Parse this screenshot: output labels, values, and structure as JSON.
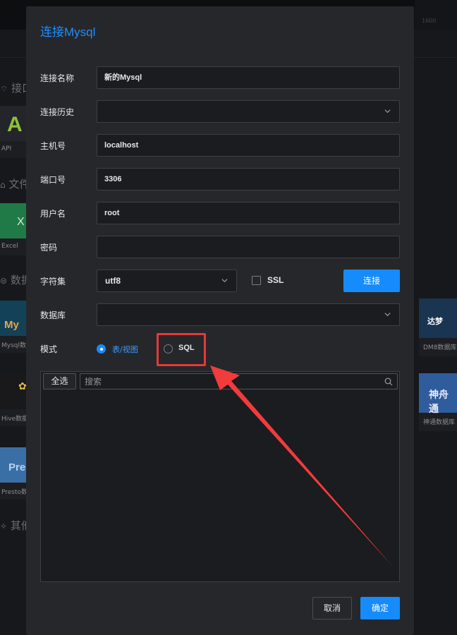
{
  "background": {
    "sections": [
      {
        "icon": "api-icon",
        "text": "接口"
      },
      {
        "icon": "file-icon",
        "text": "文件"
      },
      {
        "icon": "database-icon",
        "text": "数据"
      },
      {
        "icon": "puzzle-icon",
        "text": "其他"
      }
    ],
    "left_tiles": [
      {
        "label": "API",
        "logo": "A"
      },
      {
        "label": "Excel",
        "logo": "X"
      },
      {
        "label": "Mysql数",
        "logo": "My"
      },
      {
        "label": "Hive数据",
        "logo": ""
      },
      {
        "label": "Presto数",
        "logo": "Pre"
      }
    ],
    "right_tiles": [
      {
        "label": "DM8数据库",
        "logo": "达梦"
      },
      {
        "label": "神通数据库",
        "logo": "神舟通"
      }
    ],
    "top_right_text": "1600"
  },
  "dialog": {
    "title": "连接Mysql",
    "fields": {
      "name_label": "连接名称",
      "name_value": "新的Mysql",
      "history_label": "连接历史",
      "history_value": "",
      "host_label": "主机号",
      "host_value": "localhost",
      "port_label": "端口号",
      "port_value": "3306",
      "user_label": "用户名",
      "user_value": "root",
      "password_label": "密码",
      "password_value": "",
      "charset_label": "字符集",
      "charset_value": "utf8",
      "ssl_label": "SSL",
      "ssl_checked": false,
      "connect_label": "连接",
      "database_label": "数据库",
      "database_value": ""
    },
    "mode": {
      "label": "模式",
      "options": [
        "表/视图",
        "SQL"
      ],
      "selected": "表/视图"
    },
    "table_panel": {
      "select_all_label": "全选",
      "search_placeholder": "搜索"
    },
    "footer": {
      "cancel_label": "取消",
      "ok_label": "确定"
    }
  },
  "colors": {
    "accent": "#168cfc",
    "annotation": "#e33a3a",
    "dialog_bg": "#26272b",
    "input_bg": "#1b1c1f"
  }
}
